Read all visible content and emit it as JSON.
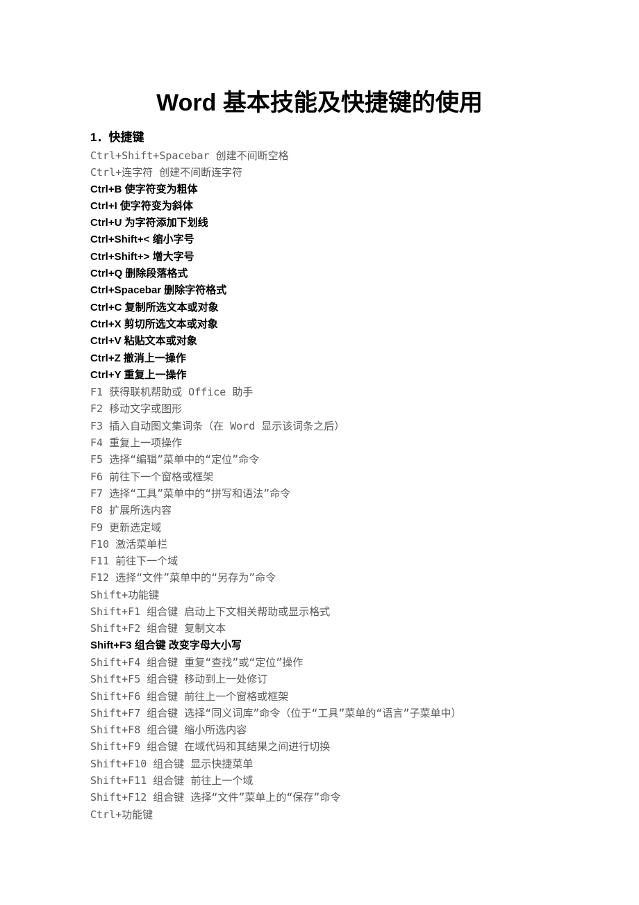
{
  "title": "Word 基本技能及快捷键的使用",
  "section1": "1．快捷键",
  "lines": [
    {
      "text": "Ctrl+Shift+Spacebar 创建不间断空格",
      "bold": false
    },
    {
      "text": "Ctrl+连字符 创建不间断连字符",
      "bold": false
    },
    {
      "text": "Ctrl+B 使字符变为粗体",
      "bold": true
    },
    {
      "text": "Ctrl+I 使字符变为斜体",
      "bold": true
    },
    {
      "text": "Ctrl+U 为字符添加下划线",
      "bold": true
    },
    {
      "text": "Ctrl+Shift+< 缩小字号",
      "bold": true
    },
    {
      "text": "Ctrl+Shift+> 增大字号",
      "bold": true
    },
    {
      "text": "Ctrl+Q 删除段落格式",
      "bold": true
    },
    {
      "text": "Ctrl+Spacebar 删除字符格式",
      "bold": true
    },
    {
      "text": "Ctrl+C 复制所选文本或对象",
      "bold": true
    },
    {
      "text": "Ctrl+X 剪切所选文本或对象",
      "bold": true
    },
    {
      "text": "Ctrl+V 粘贴文本或对象",
      "bold": true
    },
    {
      "text": "Ctrl+Z 撤消上一操作",
      "bold": true
    },
    {
      "text": "Ctrl+Y 重复上一操作",
      "bold": true
    },
    {
      "text": "F1 获得联机帮助或 Office 助手",
      "bold": false
    },
    {
      "text": "F2 移动文字或图形",
      "bold": false
    },
    {
      "text": "F3 插入自动图文集词条（在 Word 显示该词条之后）",
      "bold": false
    },
    {
      "text": "F4 重复上一项操作",
      "bold": false
    },
    {
      "text": "F5 选择“编辑”菜单中的“定位”命令",
      "bold": false
    },
    {
      "text": "F6 前往下一个窗格或框架",
      "bold": false
    },
    {
      "text": "F7 选择“工具”菜单中的“拼写和语法”命令",
      "bold": false
    },
    {
      "text": "F8 扩展所选内容",
      "bold": false
    },
    {
      "text": "F9 更新选定域",
      "bold": false
    },
    {
      "text": "F10 激活菜单栏",
      "bold": false
    },
    {
      "text": "F11 前往下一个域",
      "bold": false
    },
    {
      "text": "F12 选择“文件”菜单中的“另存为”命令",
      "bold": false
    },
    {
      "text": "Shift+功能键",
      "bold": false
    },
    {
      "text": "Shift+F1 组合键 启动上下文相关帮助或显示格式",
      "bold": false
    },
    {
      "text": "Shift+F2 组合键 复制文本",
      "bold": false
    },
    {
      "text": "Shift+F3 组合键 改变字母大小写",
      "bold": true
    },
    {
      "text": "Shift+F4 组合键 重复“查找”或“定位”操作",
      "bold": false
    },
    {
      "text": "Shift+F5 组合键 移动到上一处修订",
      "bold": false
    },
    {
      "text": "Shift+F6 组合键 前往上一个窗格或框架",
      "bold": false
    },
    {
      "text": "Shift+F7 组合键 选择“同义词库”命令（位于“工具”菜单的“语言”子菜单中）",
      "bold": false
    },
    {
      "text": "Shift+F8 组合键 缩小所选内容",
      "bold": false
    },
    {
      "text": "Shift+F9 组合键 在域代码和其结果之间进行切换",
      "bold": false
    },
    {
      "text": "Shift+F10 组合键 显示快捷菜单",
      "bold": false
    },
    {
      "text": "Shift+F11 组合键 前往上一个域",
      "bold": false
    },
    {
      "text": "Shift+F12 组合键 选择“文件”菜单上的“保存”命令",
      "bold": false
    },
    {
      "text": "Ctrl+功能键",
      "bold": false
    }
  ]
}
